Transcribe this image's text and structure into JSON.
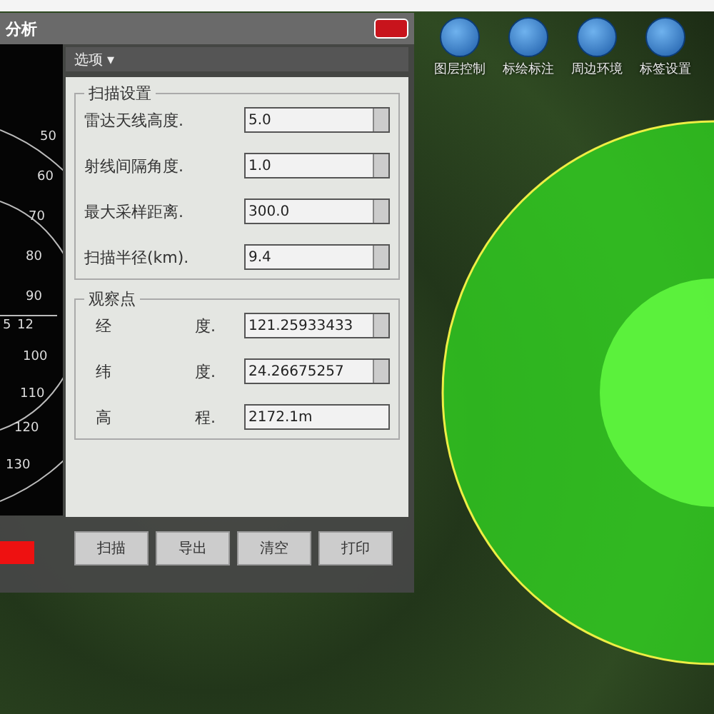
{
  "toolbar": [
    {
      "label": "图层控制"
    },
    {
      "label": "标绘标注"
    },
    {
      "label": "周边环境"
    },
    {
      "label": "标签设置"
    }
  ],
  "dialog": {
    "title": "分析",
    "tab": "选项",
    "tab_caret": "▾",
    "polar_labels": [
      "50",
      "60",
      "70",
      "80",
      "90",
      "5",
      "12",
      "100",
      "110",
      "120",
      "130"
    ],
    "scan_group": {
      "title": "扫描设置",
      "fields": [
        {
          "label": "雷达天线高度.",
          "value": "5.0"
        },
        {
          "label": "射线间隔角度.",
          "value": "1.0"
        },
        {
          "label": "最大采样距离.",
          "value": "300.0"
        },
        {
          "label": "扫描半径(km).",
          "value": "9.4"
        }
      ]
    },
    "observer_group": {
      "title": "观察点",
      "fields": [
        {
          "label_a": "经",
          "label_b": "度.",
          "value": "121.25933433",
          "kind": "spin"
        },
        {
          "label_a": "纬",
          "label_b": "度.",
          "value": "24.26675257",
          "kind": "spin"
        },
        {
          "label_a": "高",
          "label_b": "程.",
          "value": "2172.1m",
          "kind": "text"
        }
      ]
    },
    "buttons": [
      "扫描",
      "导出",
      "清空",
      "打印"
    ]
  }
}
